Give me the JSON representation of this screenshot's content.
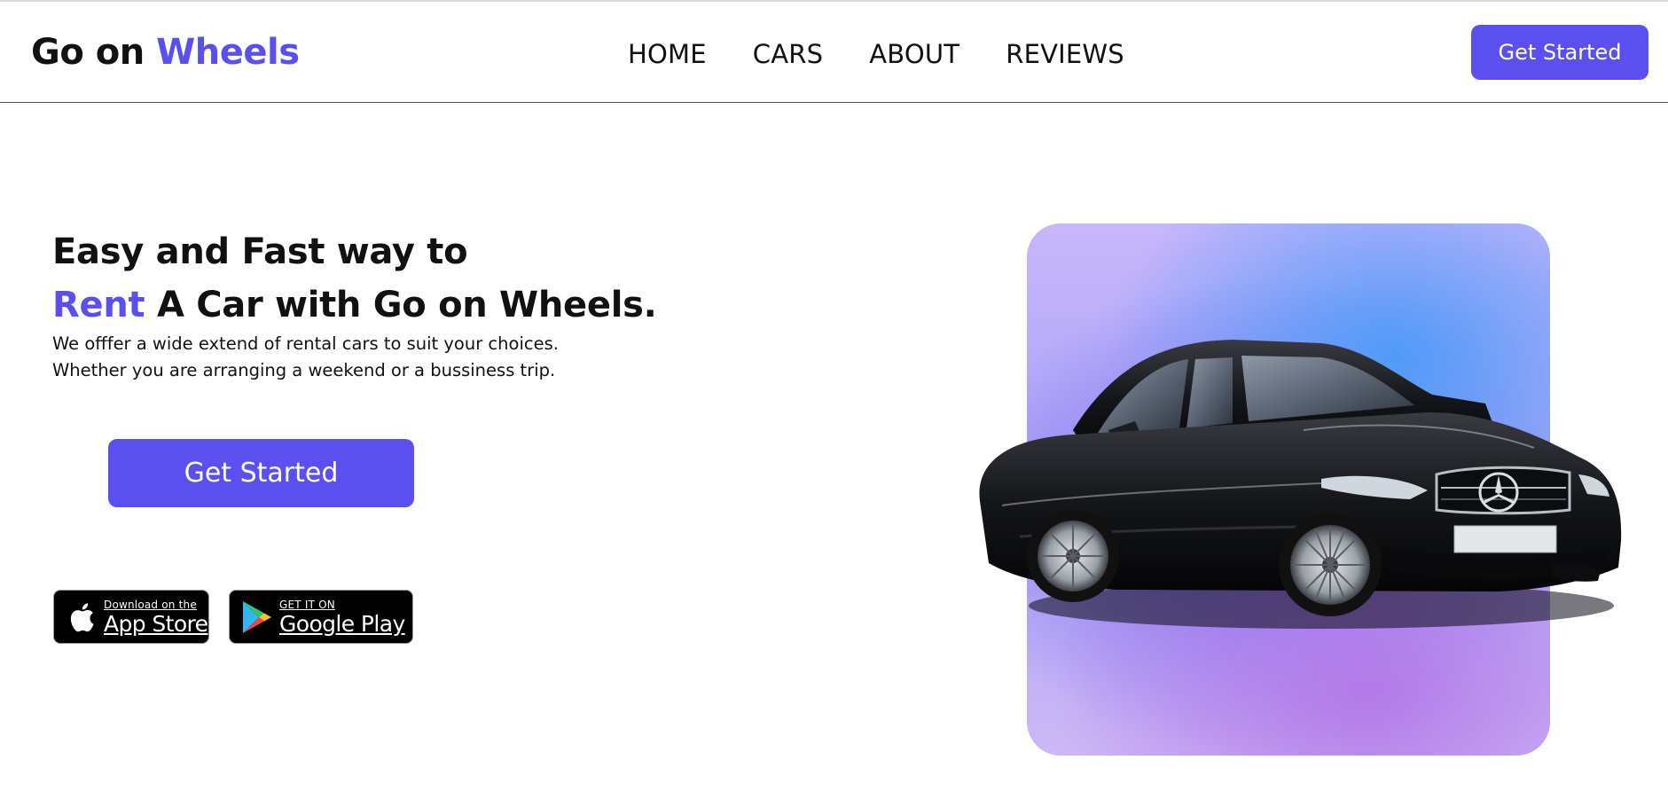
{
  "brand": {
    "part1": "Go on",
    "part2": "Wheels",
    "accent_color": "#5b4ff0"
  },
  "nav": {
    "items": [
      {
        "label": "HOME"
      },
      {
        "label": "CARS"
      },
      {
        "label": "ABOUT"
      },
      {
        "label": "REVIEWS"
      }
    ],
    "cta_label": "Get Started"
  },
  "hero": {
    "title_line1": "Easy and Fast way to",
    "title_accent": "Rent",
    "title_line2_rest": "A Car with Go on Wheels.",
    "subtitle_line1": "We offfer a wide extend of rental cars to suit your choices.",
    "subtitle_line2": "Whether you are arranging a weekend or a bussiness trip.",
    "cta_label": "Get Started"
  },
  "badges": {
    "app_store": {
      "small": "Download on the",
      "big": "App Store",
      "icon": "apple-icon"
    },
    "google_play": {
      "small": "GET IT ON",
      "big": "Google Play",
      "icon": "google-play-icon"
    }
  },
  "image": {
    "subject": "black coupe car",
    "panel_colors": [
      "#c8b6fb",
      "#4f9bf8",
      "#b47ae8"
    ]
  }
}
